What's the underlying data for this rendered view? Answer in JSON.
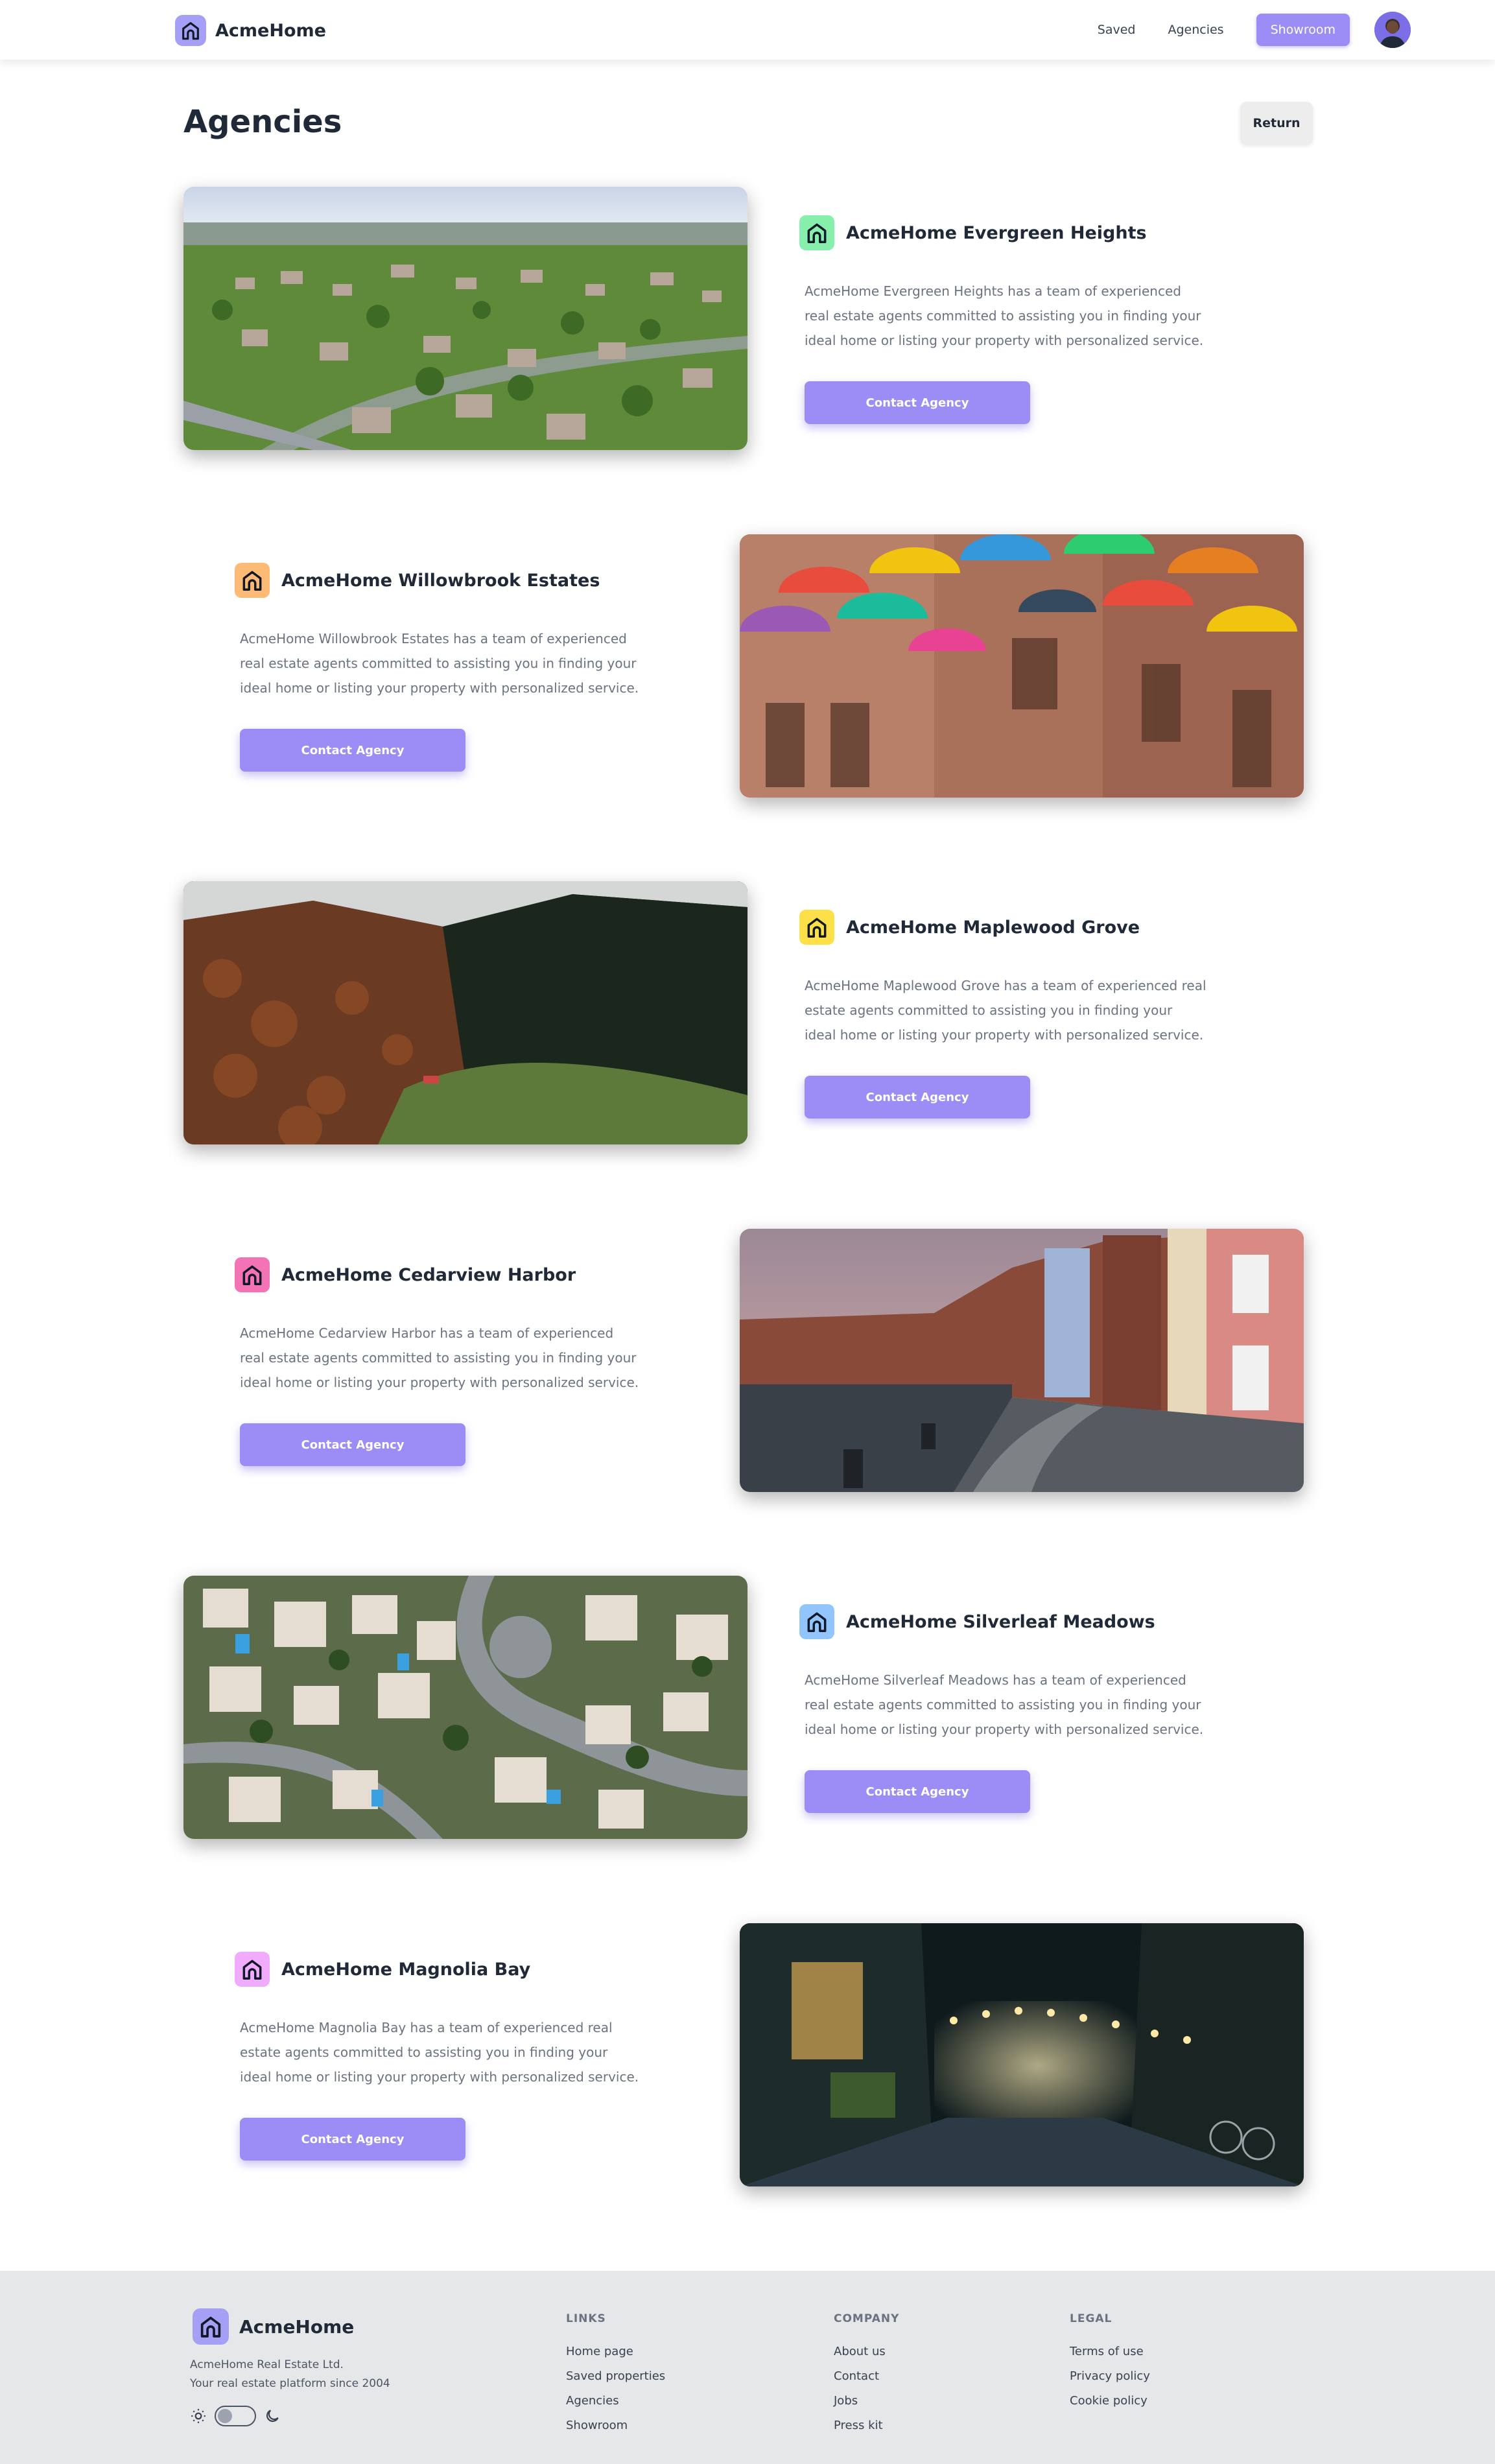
{
  "navbar": {
    "brand": "AcmeHome",
    "links": [
      "Saved",
      "Agencies"
    ],
    "cta": "Showroom"
  },
  "header": {
    "title": "Agencies",
    "return_label": "Return"
  },
  "agencies": [
    {
      "name": "AcmeHome Evergreen Heights",
      "description": "AcmeHome Evergreen Heights has a team of experienced real estate agents committed to assisting you in finding your ideal home or listing your property with personalized service.",
      "button": "Contact Agency",
      "icon_color": "#86efac",
      "image": "aerial-suburb-photo"
    },
    {
      "name": "AcmeHome Willowbrook Estates",
      "description": "AcmeHome Willowbrook Estates has a team of experienced real estate agents committed to assisting you in finding your ideal home or listing your property with personalized service.",
      "button": "Contact Agency",
      "icon_color": "#fdba74",
      "image": "umbrella-street-photo"
    },
    {
      "name": "AcmeHome Maplewood Grove",
      "description": "AcmeHome Maplewood Grove has a team of experienced real estate agents committed to assisting you in finding your ideal home or listing your property with personalized service.",
      "button": "Contact Agency",
      "icon_color": "#fde047",
      "image": "mountain-forest-photo"
    },
    {
      "name": "AcmeHome Cedarview Harbor",
      "description": "AcmeHome Cedarview Harbor has a team of experienced real estate agents committed to assisting you in finding your ideal home or listing your property with personalized service.",
      "button": "Contact Agency",
      "icon_color": "#f472b6",
      "image": "riverside-street-photo"
    },
    {
      "name": "AcmeHome Silverleaf Meadows",
      "description": "AcmeHome Silverleaf Meadows has a team of experienced real estate agents committed to assisting you in finding your ideal home or listing your property with personalized service.",
      "button": "Contact Agency",
      "icon_color": "#93c5fd",
      "image": "aerial-villas-photo"
    },
    {
      "name": "AcmeHome Magnolia Bay",
      "description": "AcmeHome Magnolia Bay has a team of experienced real estate agents committed to assisting you in finding your ideal home or listing your property with personalized service.",
      "button": "Contact Agency",
      "icon_color": "#f0abfc",
      "image": "night-alley-photo"
    }
  ],
  "footer": {
    "brand": "AcmeHome",
    "company_name": "AcmeHome Real Estate Ltd.",
    "tagline": "Your real estate platform since 2004",
    "columns": [
      {
        "title": "LINKS",
        "links": [
          "Home page",
          "Saved properties",
          "Agencies",
          "Showroom"
        ]
      },
      {
        "title": "COMPANY",
        "links": [
          "About us",
          "Contact",
          "Jobs",
          "Press kit"
        ]
      },
      {
        "title": "LEGAL",
        "links": [
          "Terms of use",
          "Privacy policy",
          "Cookie policy"
        ]
      }
    ]
  },
  "colors": {
    "accent": "#9b8cf6",
    "logo_bg": "#a5a0f5",
    "footer_bg": "#e5e7e8"
  }
}
